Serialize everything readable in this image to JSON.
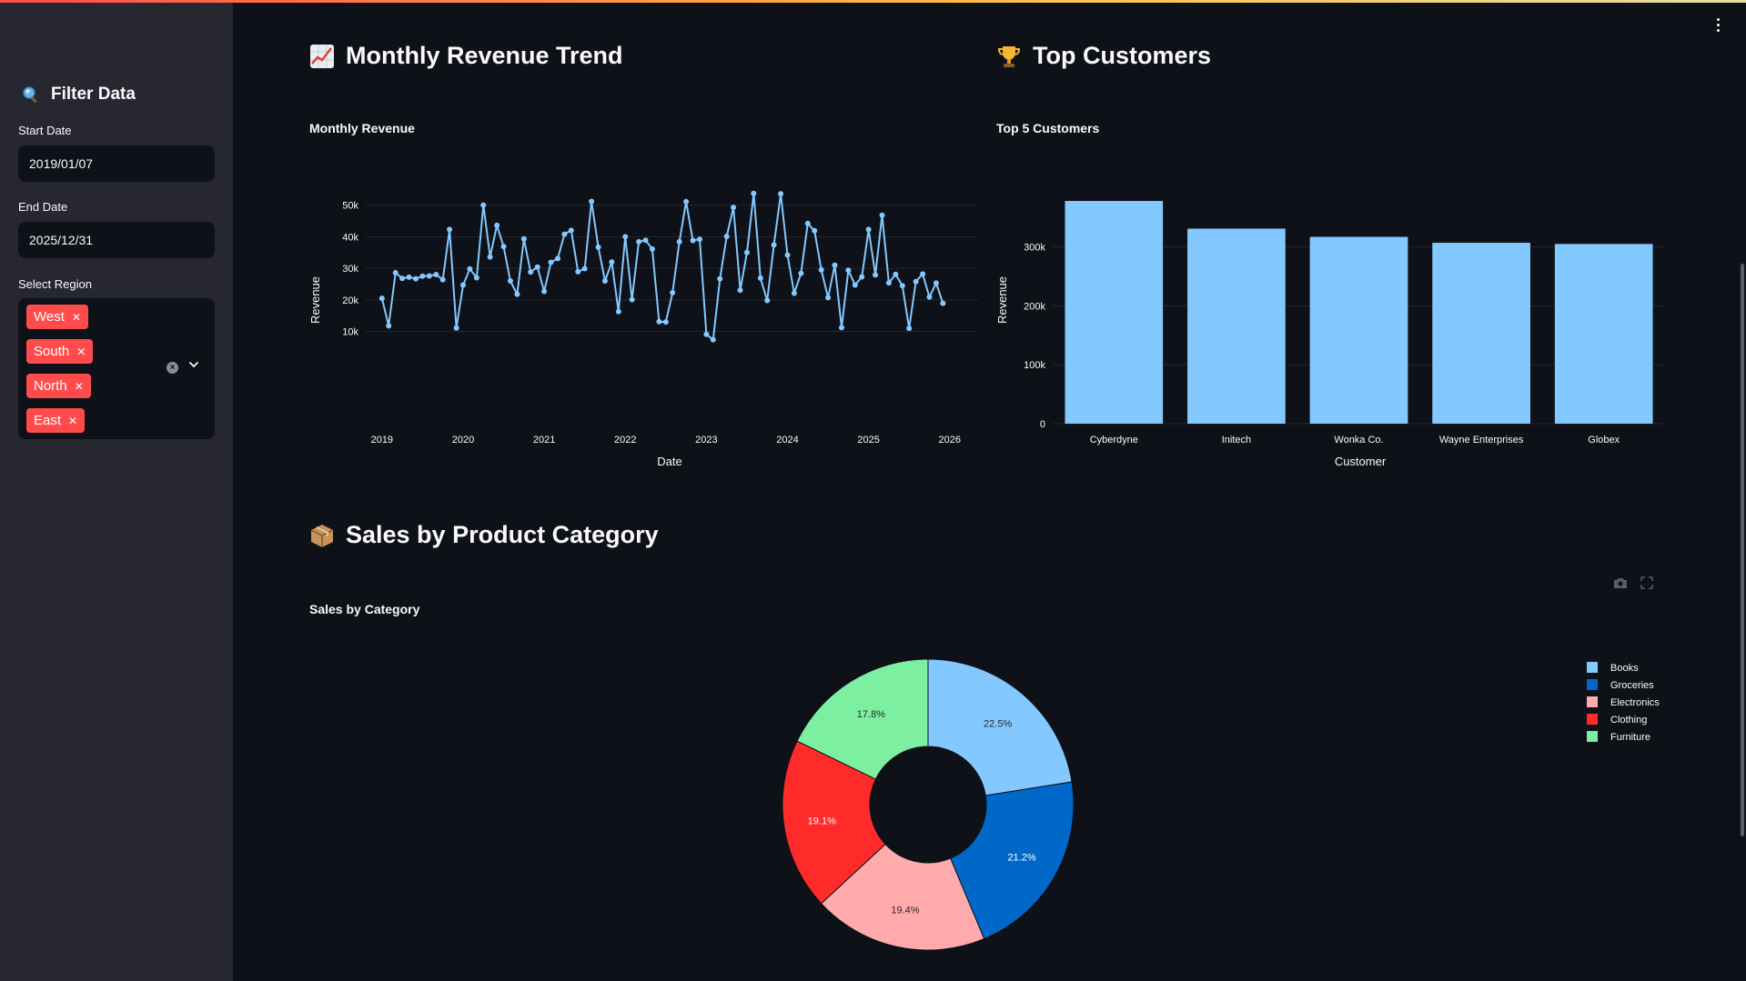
{
  "sidebar": {
    "title": "Filter Data",
    "title_icon": "magnifier-icon",
    "start_date_label": "Start Date",
    "start_date_value": "2019/01/07",
    "end_date_label": "End Date",
    "end_date_value": "2025/12/31",
    "region_label": "Select Region",
    "regions": [
      "West",
      "South",
      "North",
      "East"
    ]
  },
  "sections": {
    "revenue_title": "Monthly Revenue Trend",
    "revenue_icon": "chart-increasing-icon",
    "customers_title": "Top Customers",
    "customers_icon": "trophy-icon",
    "category_title": "Sales by Product Category",
    "category_icon": "package-icon"
  },
  "colors": {
    "accent": "#ff4b4b",
    "line": "#83c9ff",
    "bar": "#83c9ff",
    "background": "#0e1117",
    "sidebar": "#262730"
  },
  "chart_data": [
    {
      "type": "line",
      "title": "Monthly Revenue",
      "xlabel": "Date",
      "ylabel": "Revenue",
      "xticks": [
        "2019",
        "2020",
        "2021",
        "2022",
        "2023",
        "2024",
        "2025",
        "2026"
      ],
      "yticks": [
        "10k",
        "20k",
        "30k",
        "40k",
        "50k"
      ],
      "xlim": [
        2018.8,
        2026.35
      ],
      "ylim": [
        7000,
        54500
      ],
      "x": [
        2019.0,
        2019.083,
        2019.167,
        2019.25,
        2019.333,
        2019.417,
        2019.5,
        2019.583,
        2019.667,
        2019.75,
        2019.833,
        2019.917,
        2020.0,
        2020.083,
        2020.167,
        2020.25,
        2020.333,
        2020.417,
        2020.5,
        2020.583,
        2020.667,
        2020.75,
        2020.833,
        2020.917,
        2021.0,
        2021.083,
        2021.167,
        2021.25,
        2021.333,
        2021.417,
        2021.5,
        2021.583,
        2021.667,
        2021.75,
        2021.833,
        2021.917,
        2022.0,
        2022.083,
        2022.167,
        2022.25,
        2022.333,
        2022.417,
        2022.5,
        2022.583,
        2022.667,
        2022.75,
        2022.833,
        2022.917,
        2023.0,
        2023.083,
        2023.167,
        2023.25,
        2023.333,
        2023.417,
        2023.5,
        2023.583,
        2023.667,
        2023.75,
        2023.833,
        2023.917,
        2024.0,
        2024.083,
        2024.167,
        2024.25,
        2024.333,
        2024.417,
        2024.5,
        2024.583,
        2024.667,
        2024.75,
        2024.833,
        2024.917,
        2025.0,
        2025.083,
        2025.167,
        2025.25,
        2025.333,
        2025.417,
        2025.5,
        2025.583,
        2025.667,
        2025.75,
        2025.833,
        2025.917
      ],
      "values": [
        20500,
        11800,
        28600,
        26800,
        27200,
        26700,
        27500,
        27600,
        28000,
        26400,
        42300,
        11100,
        24700,
        29800,
        27000,
        50000,
        33600,
        43600,
        36900,
        26000,
        21800,
        39300,
        28800,
        30400,
        22700,
        31900,
        33100,
        40800,
        42000,
        28900,
        29900,
        51200,
        36700,
        26000,
        32000,
        16300,
        40000,
        20100,
        38400,
        38900,
        36100,
        13100,
        13000,
        22300,
        38400,
        51100,
        38800,
        39200,
        9100,
        7400,
        26700,
        40100,
        49300,
        23100,
        35000,
        53700,
        26900,
        19800,
        37400,
        53600,
        34200,
        22100,
        28400,
        44200,
        41900,
        29500,
        20700,
        31000,
        11200,
        29400,
        24700,
        27300,
        42300,
        27900,
        46800,
        25400,
        28100,
        24500,
        11000,
        25800,
        28200,
        20900,
        25300,
        18900
      ]
    },
    {
      "type": "bar",
      "title": "Top 5 Customers",
      "xlabel": "Customer",
      "ylabel": "Revenue",
      "categories": [
        "Cyberdyne",
        "Initech",
        "Wonka Co.",
        "Wayne Enterprises",
        "Globex"
      ],
      "values": [
        378000,
        331000,
        317000,
        307000,
        305000
      ],
      "yticks": [
        "0",
        "100k",
        "200k",
        "300k"
      ],
      "ylim": [
        0,
        395000
      ]
    },
    {
      "type": "pie",
      "title": "Sales by Category",
      "categories": [
        "Books",
        "Groceries",
        "Electronics",
        "Clothing",
        "Furniture"
      ],
      "values": [
        22.5,
        21.2,
        19.4,
        19.1,
        17.8
      ],
      "labels": [
        "22.5%",
        "21.2%",
        "19.4%",
        "19.1%",
        "17.8%"
      ],
      "colors": [
        "#83c9ff",
        "#0068c9",
        "#ffabab",
        "#ff2b2b",
        "#7defa1"
      ],
      "legend_position": "top-right"
    }
  ]
}
